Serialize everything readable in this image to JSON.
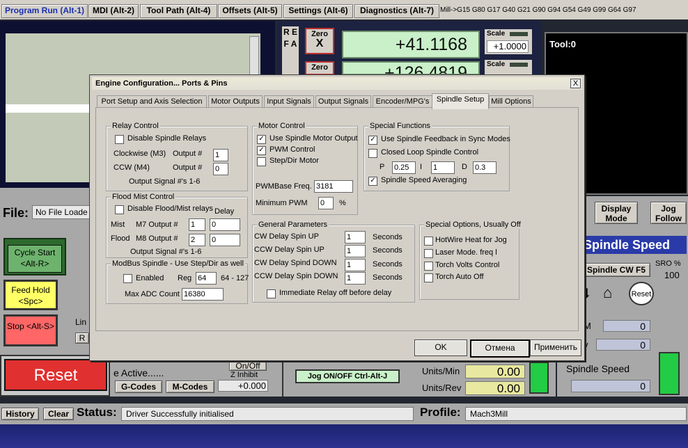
{
  "tabs_top": [
    {
      "label": "Program Run (Alt-1)"
    },
    {
      "label": "MDI (Alt-2)"
    },
    {
      "label": "Tool Path (Alt-4)"
    },
    {
      "label": "Offsets (Alt-5)"
    },
    {
      "label": "Settings (Alt-6)"
    },
    {
      "label": "Diagnostics (Alt-7)"
    }
  ],
  "gcodes_line": "Mill->G15  G80 G17 G40 G21 G90 G94 G54 G49 G99 G64 G97",
  "refa": "R E F A",
  "dro": {
    "x_zero": "Zero",
    "x_axis": "X",
    "x_value": "+41.1168",
    "y_zero": "Zero",
    "y_value": "+126.4819",
    "scale_label": "Scale",
    "scale_x": "+1.0000",
    "scale_label2": "Scale"
  },
  "tool": "Tool:0",
  "file_label": "File:",
  "file_value": "No File Loade",
  "display_mode": "Display Mode",
  "jog_follow": "Jog Follow",
  "cycle_start": "Cycle Start <Alt-R>",
  "feed_hold": "Feed Hold <Spc>",
  "stop": "Stop <Alt-S>",
  "reset": "Reset",
  "lin": "Lin",
  "r_btn": "R",
  "spindle_speed_header": "Spindle Speed",
  "spindle_cw": "Spindle CW F5",
  "sro_label": "SRO %",
  "sro_value": "100",
  "reset_round": "Reset",
  "m_label": "M",
  "v_label": "v",
  "m_value": "0",
  "v_value": "0",
  "units_min": "Units/Min",
  "units_min_val": "0.00",
  "units_rev": "Units/Rev",
  "units_rev_val": "0.00",
  "spindle_speed_lbl": "Spindle Speed",
  "spindle_speed_val": "0",
  "e_active": "e Active......",
  "on_off": "On/Off",
  "z_inhibit": "Z Inhibit",
  "z_inhibit_val": "+0.000",
  "gcodes_btn": "G-Codes",
  "mcodes_btn": "M-Codes",
  "jog_onoff": "Jog ON/OFF Ctrl-Alt-J",
  "history": "History",
  "clear": "Clear",
  "status_label": "Status:",
  "status_value": "Driver Successfully initialised",
  "profile_label": "Profile:",
  "profile_value": "Mach3Mill",
  "dialog": {
    "title": "Engine Configuration... Ports & Pins",
    "close": "X",
    "tabs": [
      {
        "label": "Port Setup and Axis Selection"
      },
      {
        "label": "Motor Outputs"
      },
      {
        "label": "Input Signals"
      },
      {
        "label": "Output Signals"
      },
      {
        "label": "Encoder/MPG's"
      },
      {
        "label": "Spindle Setup"
      },
      {
        "label": "Mill Options"
      }
    ],
    "relay": {
      "legend": "Relay Control",
      "disable": "Disable Spindle Relays",
      "cw_label": "Clockwise (M3)",
      "ccw_label": "CCW (M4)",
      "output_label": "Output #",
      "cw_value": "1",
      "ccw_value": "0",
      "signals_note": "Output Signal #'s 1-6"
    },
    "flood": {
      "legend": "Flood Mist Control",
      "disable": "Disable Flood/Mist relays",
      "delay_label": "Delay",
      "mist_label": "Mist",
      "mist_output": "M7 Output #",
      "mist_value": "1",
      "mist_delay": "0",
      "flood_label": "Flood",
      "flood_output": "M8 Output #",
      "flood_value": "2",
      "flood_delay": "0",
      "signals_note": "Output Signal #'s 1-6"
    },
    "modbus": {
      "legend": "ModBus Spindle - Use Step/Dir as well",
      "enabled": "Enabled",
      "reg_label": "Reg",
      "reg_value": "64",
      "reg_range": "64 - 127",
      "adc_label": "Max ADC Count",
      "adc_value": "16380"
    },
    "motor": {
      "legend": "Motor Control",
      "use_spindle": "Use Spindle Motor Output",
      "use_spindle_checked": true,
      "pwm": "PWM Control",
      "pwm_checked": true,
      "stepdir": "Step/Dir Motor",
      "pwmbase_label": "PWMBase Freq.",
      "pwmbase_value": "3181",
      "minpwm_label": "Minimum PWM",
      "minpwm_value": "0",
      "minpwm_unit": "%"
    },
    "special": {
      "legend": "Special Functions",
      "feedback": "Use Spindle Feedback in Sync Modes",
      "feedback_checked": true,
      "closed_loop": "Closed Loop Spindle Control",
      "p_label": "P",
      "p_value": "0.25",
      "i_label": "I",
      "i_value": "1",
      "d_label": "D",
      "d_value": "0.3",
      "averaging": "Spindle Speed Averaging",
      "averaging_checked": true
    },
    "general": {
      "legend": "General Parameters",
      "rows": [
        {
          "label": "CW Delay Spin UP",
          "value": "1",
          "unit": "Seconds"
        },
        {
          "label": "CCW Delay Spin UP",
          "value": "1",
          "unit": "Seconds"
        },
        {
          "label": "CW Delay Spind DOWN",
          "value": "1",
          "unit": "Seconds"
        },
        {
          "label": "CCW Delay Spin DOWN",
          "value": "1",
          "unit": "Seconds"
        }
      ],
      "immediate": "Immediate Relay off before delay"
    },
    "options": {
      "legend": "Special Options, Usually Off",
      "hotwire": "HotWire Heat for Jog",
      "laser": "Laser Mode. freq l",
      "torch_volts": "Torch Volts Control",
      "torch_auto": "Torch Auto Off"
    },
    "ok": "OK",
    "cancel": "Отмена",
    "apply": "Применить"
  }
}
